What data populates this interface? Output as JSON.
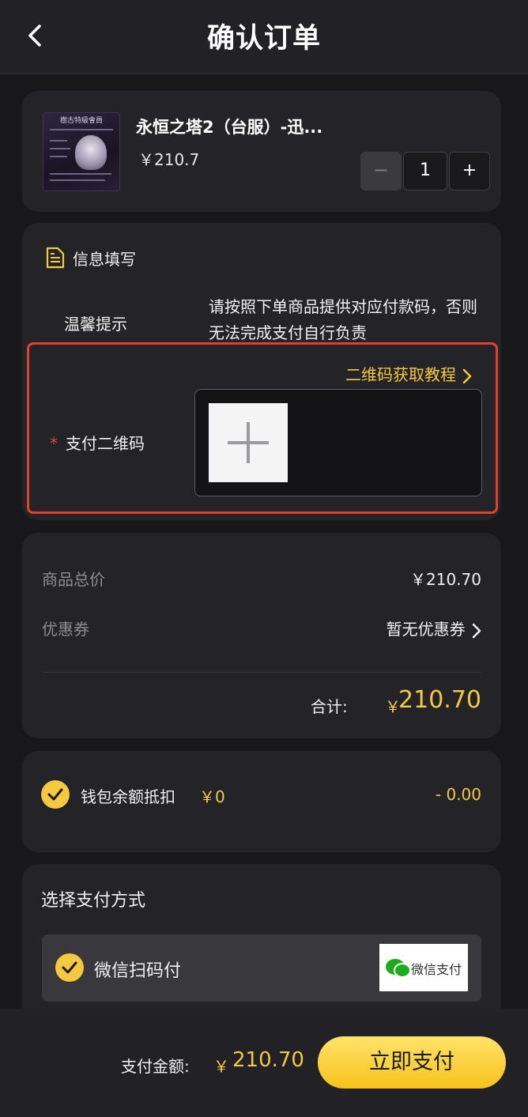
{
  "header": {
    "back_icon": "chevron-left-icon",
    "title": "确认订单"
  },
  "product": {
    "thumbnail_title": "樹古特級會員",
    "name": "永恒之塔2（台服）-迅...",
    "price": "￥210.7",
    "quantity": "1",
    "minus_label": "−",
    "plus_label": "+"
  },
  "info": {
    "icon": "document-icon",
    "title": "信息填写",
    "tip_label": "温馨提示",
    "tip_text": "请按照下单商品提供对应付款码，否则无法完成支付自行负责",
    "qr_guide_link": "二维码获取教程",
    "qr_required_mark": "*",
    "qr_label": "支付二维码",
    "upload_icon": "plus-icon"
  },
  "summary": {
    "subtotal_label": "商品总价",
    "subtotal_value": "￥210.70",
    "coupon_label": "优惠券",
    "coupon_value": "暂无优惠券",
    "total_label": "合计:",
    "total_currency": "￥",
    "total_value": "210.70"
  },
  "wallet": {
    "label": "钱包余额抵扣",
    "balance": "￥0",
    "deduction": "- 0.00"
  },
  "payment": {
    "title": "选择支付方式",
    "option_label": "微信扫码付",
    "logo_text": "微信支付"
  },
  "footer": {
    "amount_label": "支付金额:",
    "currency": "￥",
    "amount": "210.70",
    "pay_button": "立即支付"
  },
  "colors": {
    "background": "#18181b",
    "card": "#242428",
    "accent": "#f5c842",
    "highlight_border": "#e0402e",
    "wechat_green": "#1aad19"
  }
}
